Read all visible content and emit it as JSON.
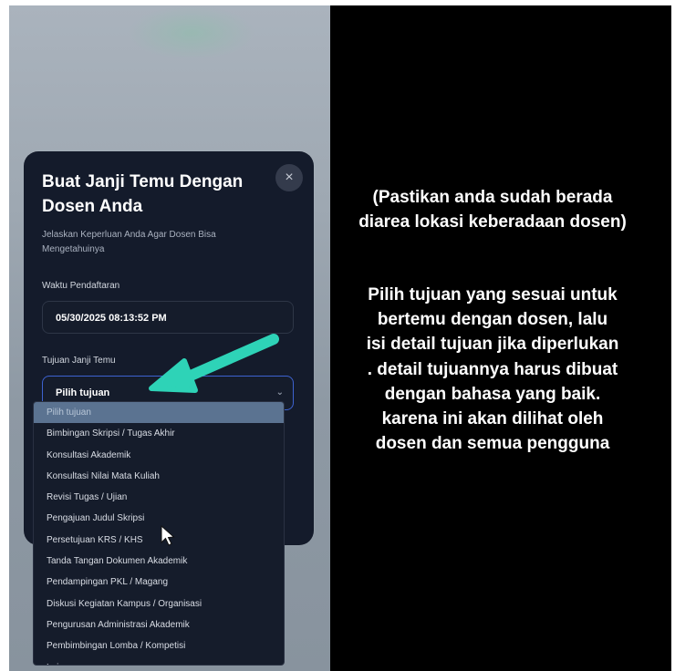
{
  "modal": {
    "title": "Buat Janji Temu Dengan Dosen Anda",
    "close_icon": "×",
    "subtitle": "Jelaskan Keperluan Anda Agar Dosen Bisa Mengetahuinya",
    "waktu_label": "Waktu Pendaftaran",
    "waktu_value": "05/30/2025 08:13:52 PM",
    "tujuan_label": "Tujuan Janji Temu",
    "tujuan_selected": "Pilih tujuan",
    "chevron_icon": "⌄"
  },
  "dropdown": {
    "options": [
      "Pilih tujuan",
      "Bimbingan Skripsi / Tugas Akhir",
      "Konsultasi Akademik",
      "Konsultasi Nilai Mata Kuliah",
      "Revisi Tugas / Ujian",
      "Pengajuan Judul Skripsi",
      "Persetujuan KRS / KHS",
      "Tanda Tangan Dokumen Akademik",
      "Pendampingan PKL / Magang",
      "Diskusi Kegiatan Kampus / Organisasi",
      "Pengurusan Administrasi Akademik",
      "Pembimbingan Lomba / Kompetisi",
      "Lainnya"
    ]
  },
  "caption": {
    "line1": "(Pastikan anda sudah berada",
    "line2": "diarea lokasi keberadaan dosen)",
    "body_lines": [
      "Pilih tujuan yang sesuai untuk",
      "bertemu dengan dosen, lalu",
      "isi detail tujuan jika diperlukan",
      ". detail tujuannya harus dibuat",
      "dengan bahasa yang baik.",
      "karena ini akan dilihat oleh",
      "dosen dan semua pengguna"
    ]
  },
  "colors": {
    "modal_bg": "#141b2b",
    "select_border": "#3d62d0",
    "arrow": "#2ed3b7",
    "selected_option": "#5b7391"
  },
  "icons": {
    "close": "close-icon",
    "chevron": "chevron-down-icon",
    "cursor": "mouse-cursor-icon",
    "annotation_arrow": "arrow-annotation-icon"
  }
}
